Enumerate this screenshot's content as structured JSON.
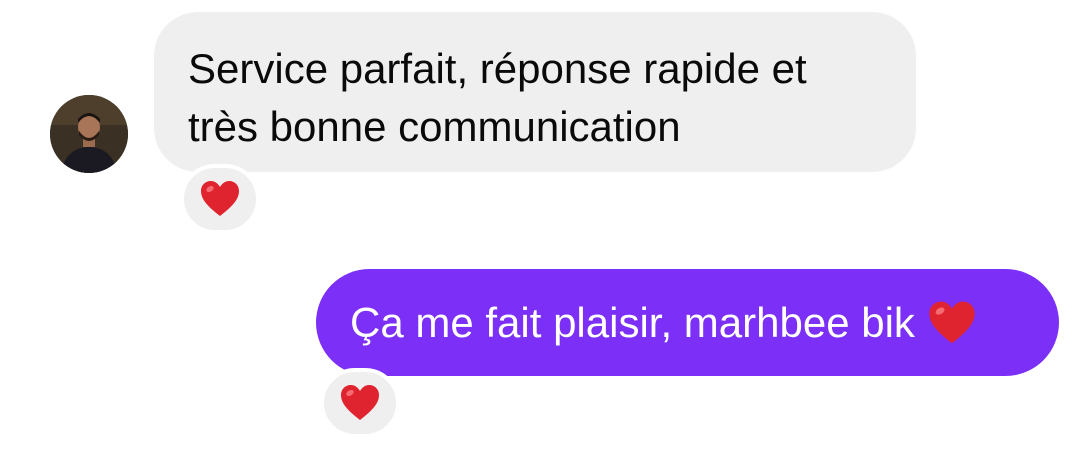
{
  "incoming_message": {
    "lines": [
      "Service parfait, réponse rapide et",
      "très bonne communication"
    ],
    "reaction": "red-heart"
  },
  "outgoing_message": {
    "text": "Ça me fait plaisir, marhbee bik",
    "trailing_emoji": "red-heart",
    "reaction": "red-heart"
  },
  "colors": {
    "incoming_bubble": "#efefef",
    "outgoing_bubble": "#7b2ff7",
    "heart": "#e0242f",
    "background": "#ffffff"
  }
}
